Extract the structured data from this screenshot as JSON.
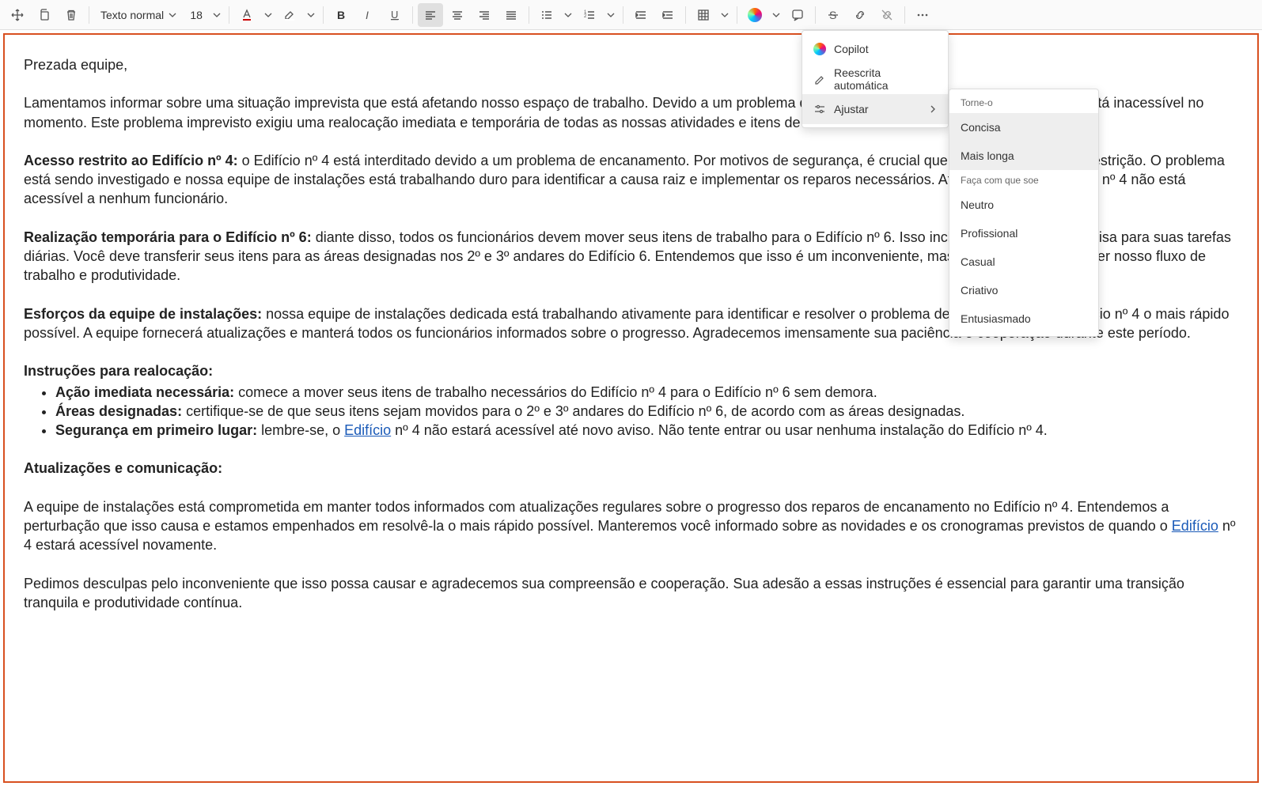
{
  "toolbar": {
    "style_label": "Texto normal",
    "font_size": "18"
  },
  "copilot_menu": {
    "copilot": "Copilot",
    "rewrite": "Reescrita automática",
    "adjust": "Ajustar"
  },
  "adjust_menu": {
    "header1": "Torne-o",
    "concise": "Concisa",
    "longer": "Mais longa",
    "header2": "Faça com que soe",
    "neutral": "Neutro",
    "professional": "Profissional",
    "casual": "Casual",
    "creative": "Criativo",
    "enthusiastic": "Entusiasmado"
  },
  "doc": {
    "greeting": "Prezada equipe,",
    "p1_a": "Lamentamos informar sobre uma situação imprevista que está afetando nosso espaço de trabalho. Devido a um problema de encanamento significativo, o ",
    "link_edificio": "Edifício",
    "p1_b": " nº 4 está inacessível no momento. Este problema imprevisto exigiu uma realocação imediata e temporária de todas as nossas atividades e itens de trabalho do Edifício nº 4 para o Edifício nº 6.",
    "p2_head": "Acesso restrito ao Edifício nº 4:",
    "p2_a": " o Edifício nº 4 está interditado devido a um problema de encanamento. Por motivos de segurança, é crucial que todos cumpram essa restrição. O problema está sendo investigado e nossa equipe de instalações está trabalhando duro para identificar a causa raiz e implementar os reparos necessários. Até novo aviso, o ",
    "p2_b": " nº 4 não está acessível a nenhum funcionário.",
    "p3_head": "Realização temporária para o Edifício nº 6:",
    "p3_a": " diante disso, todos os funcionários devem mover seus itens de trabalho para o Edifício nº 6. Isso inclui tudo o que você precisa para suas tarefas diárias. Você deve transferir seus itens para as áreas designadas nos 2º e 3º andares do Edifício 6. Entendemos que isso é um inconveniente, mas é essencial para manter nosso fluxo de trabalho e produtividade.",
    "p4_head": "Esforços da equipe de instalações:",
    "p4_a": " nossa equipe de instalações dedicada está trabalhando ativamente para identificar e resolver o problema de encanamento no Edifício nº 4 o mais rápido possível. A equipe fornecerá atualizações e manterá todos os funcionários informados sobre o progresso. Agradecemos imensamente sua paciência e cooperação durante este período.",
    "p5_head": "Instruções para realocação:",
    "li1_head": "Ação imediata necessária:",
    "li1_text": " comece a mover seus itens de trabalho necessários do Edifício nº 4 para o Edifício nº 6 sem demora.",
    "li2_head": "Áreas designadas:",
    "li2_text": " certifique-se de que seus itens sejam movidos para o 2º e 3º andares do Edifício nº 6, de acordo com as áreas designadas.",
    "li3_head": "Segurança em primeiro lugar:",
    "li3_a": " lembre-se, o ",
    "li3_b": " nº 4 não estará acessível até novo aviso. Não tente entrar ou usar nenhuma instalação do Edifício nº 4.",
    "p6_head": "Atualizações e comunicação:",
    "p7_a": "A equipe de instalações está comprometida em manter todos informados com atualizações regulares sobre o progresso dos reparos de encanamento no Edifício nº 4. Entendemos a perturbação que isso causa e estamos empenhados em resolvê-la o mais rápido possível. Manteremos você informado sobre as novidades e os cronogramas previstos de quando o ",
    "p7_b": " nº 4 estará acessível novamente.",
    "p8": "Pedimos desculpas pelo inconveniente que isso possa causar e agradecemos sua compreensão e cooperação. Sua adesão a essas instruções é essencial para garantir uma transição tranquila e produtividade contínua."
  }
}
